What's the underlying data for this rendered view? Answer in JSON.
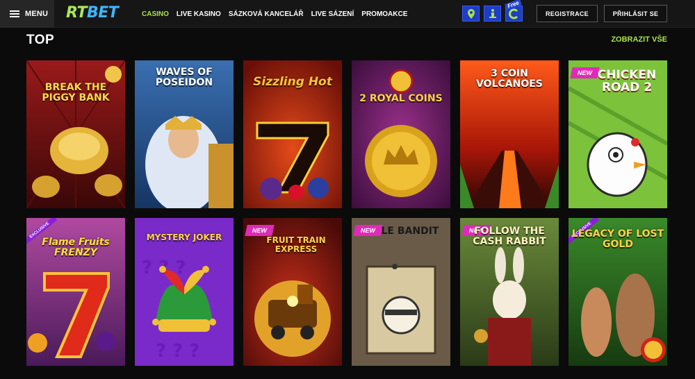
{
  "header": {
    "menu_label": "MENU",
    "logo_part1": "RT",
    "logo_part2": "BET",
    "nav": [
      {
        "label": "CASINO",
        "active": true
      },
      {
        "label": "LIVE KASINO",
        "active": false
      },
      {
        "label": "SÁZKOVÁ KANCELÁŘ",
        "active": false
      },
      {
        "label": "LIVE SÁZENÍ",
        "active": false
      },
      {
        "label": "PROMOAKCE",
        "active": false
      }
    ],
    "icons": [
      "map-pin-icon",
      "info-person-icon",
      "free-c-icon"
    ],
    "free_label": "Free",
    "register_label": "REGISTRACE",
    "login_label": "PŘIHLÁSIT SE"
  },
  "section": {
    "title": "TOP",
    "show_all": "ZOBRAZIT VŠE"
  },
  "games": [
    {
      "name": "BREAK the PIGGY BANK",
      "badge": ""
    },
    {
      "name": "WAVES OF POSEIDON",
      "badge": ""
    },
    {
      "name": "Sizzling Hot",
      "badge": ""
    },
    {
      "name": "2 ROYAL COINS",
      "badge": ""
    },
    {
      "name": "3 COIN VOLCANOES",
      "badge": ""
    },
    {
      "name": "CHICKEN ROAD 2",
      "badge": "NEW"
    },
    {
      "name": "Flame Fruits FRENZY",
      "badge": "EXCLUSIVE"
    },
    {
      "name": "MYSTERY JOKER",
      "badge": ""
    },
    {
      "name": "FRUIT TRAIN EXPRESS",
      "badge": "NEW"
    },
    {
      "name": "LE BANDIT",
      "badge": "NEW"
    },
    {
      "name": "FOLLOW THE CASH RABBIT",
      "badge": "NEW"
    },
    {
      "name": "LEGACY OF LOST GOLD",
      "badge": "EXCLUSIVE"
    }
  ],
  "colors": {
    "accent_green": "#a9e34b",
    "icon_blue": "#1e3fc2",
    "badge_pink": "#e02ab9",
    "badge_purple": "#8b1fd6"
  }
}
